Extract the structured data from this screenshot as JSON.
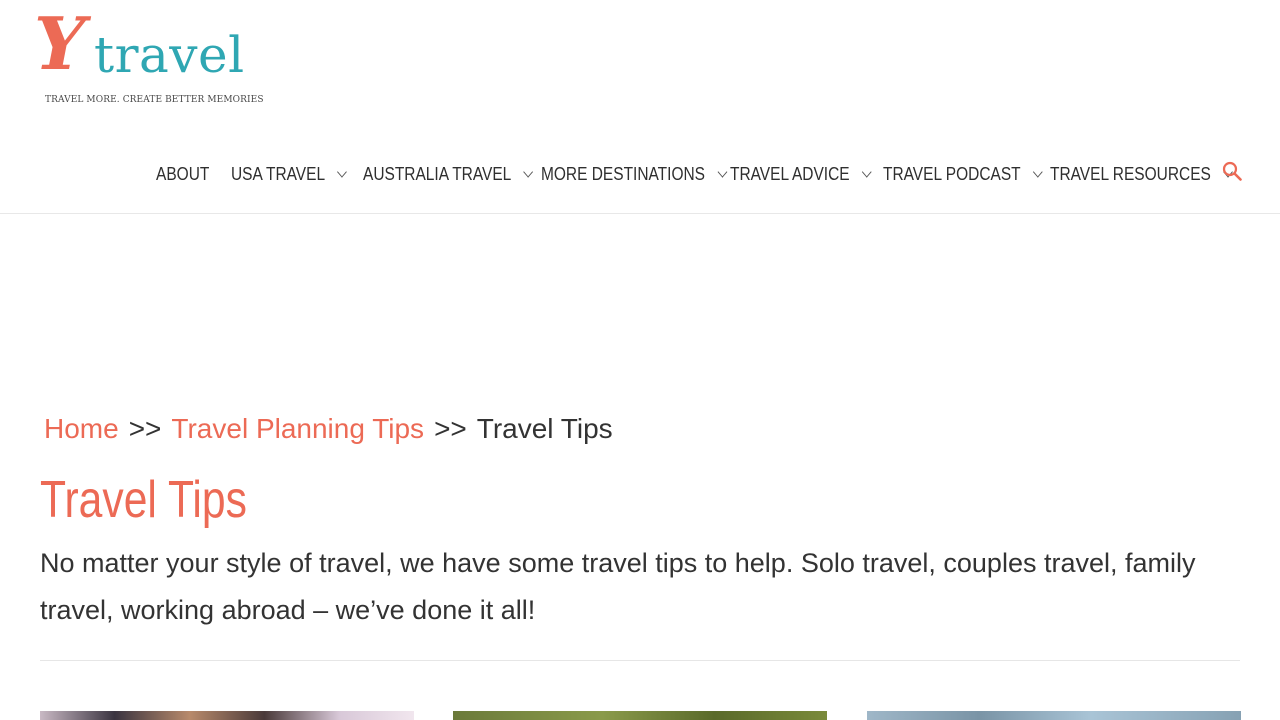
{
  "brand": {
    "logo_letter": "Y",
    "logo_word": "travel",
    "tagline": "TRAVEL MORE. CREATE BETTER MEMORIES",
    "colors": {
      "coral": "#ec6a55",
      "teal": "#2fa7b3"
    }
  },
  "nav": {
    "items": [
      {
        "label": "ABOUT",
        "dropdown": false
      },
      {
        "label": "USA TRAVEL",
        "dropdown": true
      },
      {
        "label": "AUSTRALIA TRAVEL",
        "dropdown": true
      },
      {
        "label": "MORE DESTINATIONS",
        "dropdown": true
      },
      {
        "label": "TRAVEL ADVICE",
        "dropdown": true
      },
      {
        "label": "TRAVEL PODCAST",
        "dropdown": true
      },
      {
        "label": "TRAVEL RESOURCES",
        "dropdown": true
      }
    ],
    "search_icon": "search-icon"
  },
  "breadcrumb": {
    "home": "Home",
    "separator": ">>",
    "parent": "Travel Planning Tips",
    "current": "Travel Tips"
  },
  "page": {
    "title": "Travel Tips",
    "intro": "No matter your style of travel, we have some travel tips to help. Solo travel, couples travel, family travel, working abroad – we’ve done it all!"
  }
}
